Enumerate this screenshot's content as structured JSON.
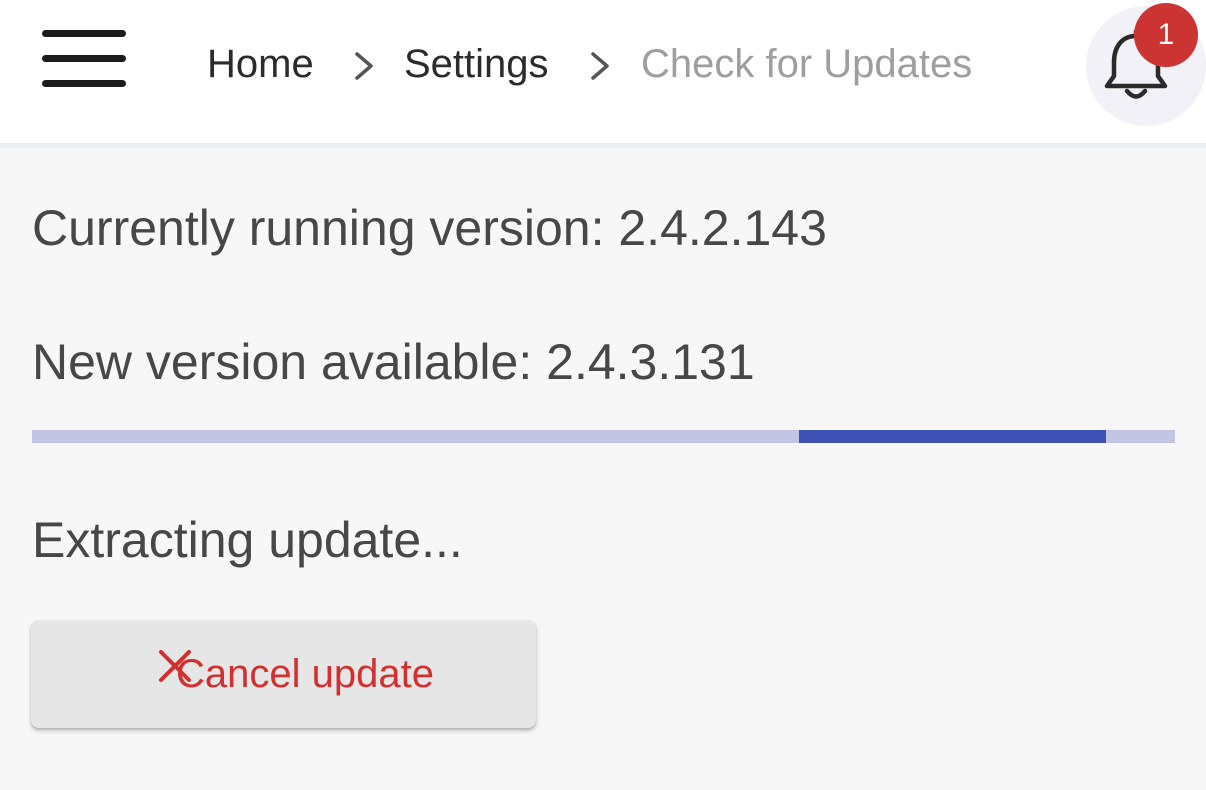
{
  "header": {
    "menu_icon": "hamburger-menu-icon",
    "breadcrumb": [
      {
        "label": "Home"
      },
      {
        "label": "Settings"
      },
      {
        "label": "Check for Updates"
      }
    ],
    "separator_icon": "chevron-right-icon",
    "notifications": {
      "icon": "bell-icon",
      "count": "1",
      "badge_color": "#cc3434"
    }
  },
  "main": {
    "current_version_text": "Currently running version: 2.4.2.143",
    "new_version_text": "New version available: 2.4.3.131",
    "progress": {
      "indeterminate": true,
      "track_color": "#c3c5e4",
      "bar_color": "#3f51b5"
    },
    "status_text": "Extracting update...",
    "cancel_button": {
      "icon": "close-icon",
      "label": "Cancel update",
      "color": "#d32f2f"
    }
  }
}
